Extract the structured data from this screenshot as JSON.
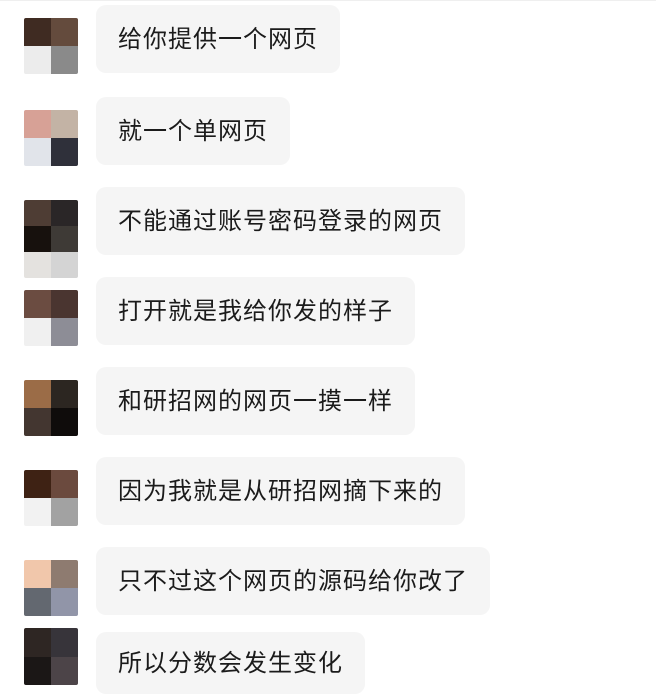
{
  "messages": [
    {
      "text": "给你提供一个网页",
      "avatar_colors": [
        "#3f2b22",
        "#644b3d",
        "#ececec",
        "#8a8a8a"
      ]
    },
    {
      "text": "就一个单网页",
      "avatar_colors": [
        "#d7a196",
        "#c3b3a5",
        "#e1e4ea",
        "#2f303a"
      ]
    },
    {
      "text": "不能通过账号密码登录的网页",
      "avatar_colors": [
        "#4e3d34",
        "#2a2627",
        "#17110d",
        "#3e3a36",
        "#e4e2df",
        "#d4d4d4"
      ]
    },
    {
      "text": "打开就是我给你发的样子",
      "avatar_colors": [
        "#6b4c41",
        "#4a3530",
        "#f0f0f0",
        "#8d8d96"
      ]
    },
    {
      "text": "和研招网的网页一摸一样",
      "avatar_colors": [
        "#9b6c47",
        "#2c2621",
        "#433630",
        "#0f0c0b"
      ]
    },
    {
      "text": "因为我就是从研招网摘下来的",
      "avatar_colors": [
        "#3e2214",
        "#6b4a3e",
        "#f2f2f2",
        "#a2a2a2"
      ]
    },
    {
      "text": "只不过这个网页的源码给你改了",
      "avatar_colors": [
        "#f1c7ab",
        "#8e7b70",
        "#636870",
        "#9195a8"
      ]
    },
    {
      "text": "所以分数会发生变化",
      "avatar_colors": [
        "#2e2623",
        "#37343a",
        "#1b1716",
        "#4c4448"
      ]
    }
  ],
  "colors": {
    "bubble_bg": "#f5f5f5",
    "text": "#1b1b1b",
    "background": "#ffffff"
  }
}
